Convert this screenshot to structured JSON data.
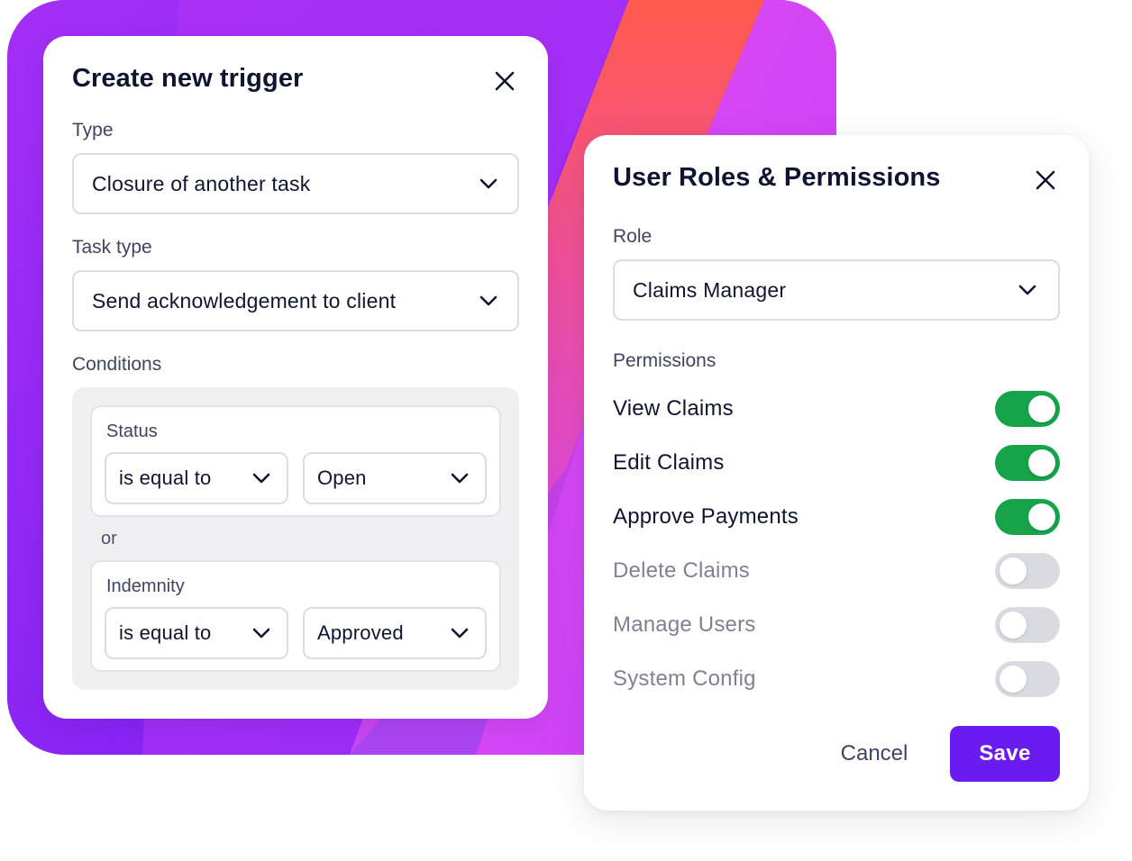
{
  "colors": {
    "accent": "#6a1cf0",
    "toggle_on": "#16a34a",
    "toggle_off": "#d9dbe0",
    "text_primary": "#0f1530",
    "text_muted": "#7d8294",
    "backdrop_purple": "#8b25f5",
    "backdrop_pink": "#ff5a5f",
    "backdrop_magenta": "#d946ef"
  },
  "trigger_dialog": {
    "title": "Create new trigger",
    "close_icon": "close-icon",
    "type": {
      "label": "Type",
      "value": "Closure of another task"
    },
    "task_type": {
      "label": "Task type",
      "value": "Send acknowledgement to client"
    },
    "conditions": {
      "label": "Conditions",
      "groups": [
        {
          "field": "Status",
          "operator": "is equal to",
          "value": "Open"
        },
        {
          "field": "Indemnity",
          "operator": "is equal to",
          "value": "Approved"
        }
      ],
      "joiner": "or"
    }
  },
  "roles_dialog": {
    "title": "User Roles & Permissions",
    "close_icon": "close-icon",
    "role": {
      "label": "Role",
      "value": "Claims Manager"
    },
    "permissions_label": "Permissions",
    "permissions": [
      {
        "label": "View Claims",
        "enabled": true
      },
      {
        "label": "Edit Claims",
        "enabled": true
      },
      {
        "label": "Approve Payments",
        "enabled": true
      },
      {
        "label": "Delete Claims",
        "enabled": false
      },
      {
        "label": "Manage Users",
        "enabled": false
      },
      {
        "label": "System Config",
        "enabled": false
      }
    ],
    "cancel_label": "Cancel",
    "save_label": "Save"
  }
}
